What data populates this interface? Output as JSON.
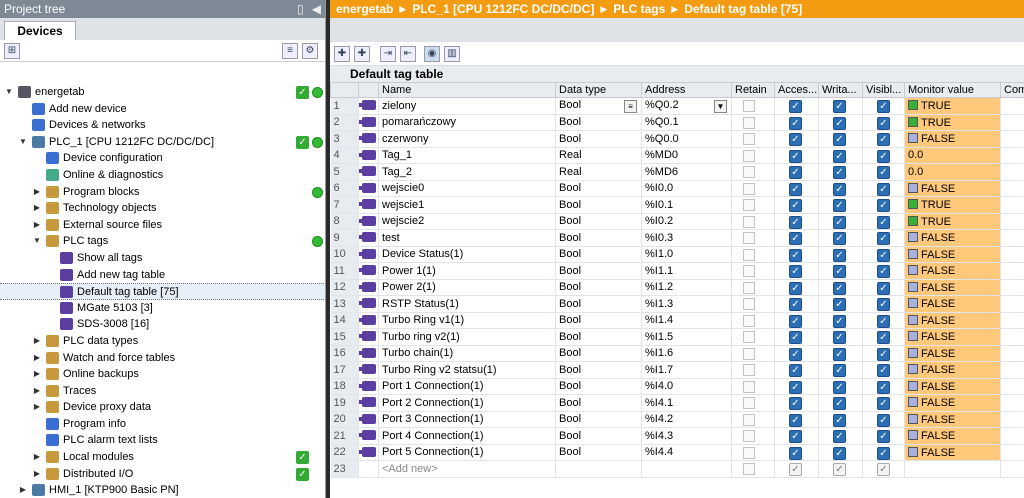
{
  "left_pane": {
    "title": "Project tree",
    "tab": "Devices",
    "tree": [
      {
        "label": "energetab",
        "icon": "project-icon",
        "level": 0,
        "expander": "▼",
        "check": true,
        "dot": true
      },
      {
        "label": "Add new device",
        "icon": "add-device-icon",
        "level": 1,
        "expander": "",
        "check": false,
        "dot": false
      },
      {
        "label": "Devices & networks",
        "icon": "network-icon",
        "level": 1,
        "expander": "",
        "check": false,
        "dot": false
      },
      {
        "label": "PLC_1 [CPU 1212FC DC/DC/DC]",
        "icon": "plc-icon",
        "level": 1,
        "expander": "▼",
        "check": true,
        "dot": true
      },
      {
        "label": "Device configuration",
        "icon": "device-config-icon",
        "level": 2,
        "expander": "",
        "check": false,
        "dot": false
      },
      {
        "label": "Online & diagnostics",
        "icon": "diagnostics-icon",
        "level": 2,
        "expander": "",
        "check": false,
        "dot": false
      },
      {
        "label": "Program blocks",
        "icon": "folder-icon",
        "level": 2,
        "expander": "▶",
        "check": false,
        "dot": true
      },
      {
        "label": "Technology objects",
        "icon": "folder-icon",
        "level": 2,
        "expander": "▶",
        "check": false,
        "dot": false
      },
      {
        "label": "External source files",
        "icon": "folder-icon",
        "level": 2,
        "expander": "▶",
        "check": false,
        "dot": false
      },
      {
        "label": "PLC tags",
        "icon": "folder-icon",
        "level": 2,
        "expander": "▼",
        "check": false,
        "dot": true
      },
      {
        "label": "Show all tags",
        "icon": "tags-icon",
        "level": 3,
        "expander": "",
        "check": false,
        "dot": false
      },
      {
        "label": "Add new tag table",
        "icon": "add-table-icon",
        "level": 3,
        "expander": "",
        "check": false,
        "dot": false
      },
      {
        "label": "Default tag table [75]",
        "icon": "tag-table-icon",
        "level": 3,
        "expander": "",
        "check": false,
        "dot": false,
        "selected": true
      },
      {
        "label": "MGate 5103 [3]",
        "icon": "tag-table-icon",
        "level": 3,
        "expander": "",
        "check": false,
        "dot": false
      },
      {
        "label": "SDS-3008 [16]",
        "icon": "tag-table-icon",
        "level": 3,
        "expander": "",
        "check": false,
        "dot": false
      },
      {
        "label": "PLC data types",
        "icon": "folder-icon",
        "level": 2,
        "expander": "▶",
        "check": false,
        "dot": false
      },
      {
        "label": "Watch and force tables",
        "icon": "folder-icon",
        "level": 2,
        "expander": "▶",
        "check": false,
        "dot": false
      },
      {
        "label": "Online backups",
        "icon": "folder-icon",
        "level": 2,
        "expander": "▶",
        "check": false,
        "dot": false
      },
      {
        "label": "Traces",
        "icon": "folder-icon",
        "level": 2,
        "expander": "▶",
        "check": false,
        "dot": false
      },
      {
        "label": "Device proxy data",
        "icon": "folder-icon",
        "level": 2,
        "expander": "▶",
        "check": false,
        "dot": false
      },
      {
        "label": "Program info",
        "icon": "info-icon",
        "level": 2,
        "expander": "",
        "check": false,
        "dot": false
      },
      {
        "label": "PLC alarm text lists",
        "icon": "alarm-list-icon",
        "level": 2,
        "expander": "",
        "check": false,
        "dot": false
      },
      {
        "label": "Local modules",
        "icon": "folder-icon",
        "level": 2,
        "expander": "▶",
        "check": true,
        "dot": false
      },
      {
        "label": "Distributed I/O",
        "icon": "folder-icon",
        "level": 2,
        "expander": "▶",
        "check": true,
        "dot": false
      },
      {
        "label": "HMI_1 [KTP900 Basic PN]",
        "icon": "hmi-icon",
        "level": 1,
        "expander": "▶",
        "check": false,
        "dot": false
      }
    ]
  },
  "breadcrumb": [
    "energetab",
    "PLC_1 [CPU 1212FC DC/DC/DC]",
    "PLC tags",
    "Default tag table [75]"
  ],
  "table_title": "Default tag table",
  "columns": [
    "Name",
    "Data type",
    "Address",
    "Retain",
    "Acces...",
    "Writa...",
    "Visibl...",
    "Monitor value",
    "Com"
  ],
  "rows": [
    {
      "n": "1",
      "name": "zielony",
      "type": "Bool",
      "addr": "%Q0.2",
      "mon": "TRUE",
      "state": "true"
    },
    {
      "n": "2",
      "name": "pomarańczowy",
      "type": "Bool",
      "addr": "%Q0.1",
      "mon": "TRUE",
      "state": "true"
    },
    {
      "n": "3",
      "name": "czerwony",
      "type": "Bool",
      "addr": "%Q0.0",
      "mon": "FALSE",
      "state": "false"
    },
    {
      "n": "4",
      "name": "Tag_1",
      "type": "Real",
      "addr": "%MD0",
      "mon": "0.0",
      "state": "none"
    },
    {
      "n": "5",
      "name": "Tag_2",
      "type": "Real",
      "addr": "%MD6",
      "mon": "0.0",
      "state": "none"
    },
    {
      "n": "6",
      "name": "wejscie0",
      "type": "Bool",
      "addr": "%I0.0",
      "mon": "FALSE",
      "state": "false"
    },
    {
      "n": "7",
      "name": "wejscie1",
      "type": "Bool",
      "addr": "%I0.1",
      "mon": "TRUE",
      "state": "true"
    },
    {
      "n": "8",
      "name": "wejscie2",
      "type": "Bool",
      "addr": "%I0.2",
      "mon": "TRUE",
      "state": "true"
    },
    {
      "n": "9",
      "name": "test",
      "type": "Bool",
      "addr": "%I0.3",
      "mon": "FALSE",
      "state": "false"
    },
    {
      "n": "10",
      "name": "Device Status(1)",
      "type": "Bool",
      "addr": "%I1.0",
      "mon": "FALSE",
      "state": "false"
    },
    {
      "n": "11",
      "name": "Power 1(1)",
      "type": "Bool",
      "addr": "%I1.1",
      "mon": "FALSE",
      "state": "false"
    },
    {
      "n": "12",
      "name": "Power 2(1)",
      "type": "Bool",
      "addr": "%I1.2",
      "mon": "FALSE",
      "state": "false"
    },
    {
      "n": "13",
      "name": "RSTP Status(1)",
      "type": "Bool",
      "addr": "%I1.3",
      "mon": "FALSE",
      "state": "false"
    },
    {
      "n": "14",
      "name": "Turbo Ring v1(1)",
      "type": "Bool",
      "addr": "%I1.4",
      "mon": "FALSE",
      "state": "false"
    },
    {
      "n": "15",
      "name": "Turbo ring v2(1)",
      "type": "Bool",
      "addr": "%I1.5",
      "mon": "FALSE",
      "state": "false"
    },
    {
      "n": "16",
      "name": "Turbo chain(1)",
      "type": "Bool",
      "addr": "%I1.6",
      "mon": "FALSE",
      "state": "false"
    },
    {
      "n": "17",
      "name": "Turbo Ring v2 statsu(1)",
      "type": "Bool",
      "addr": "%I1.7",
      "mon": "FALSE",
      "state": "false"
    },
    {
      "n": "18",
      "name": "Port 1 Connection(1)",
      "type": "Bool",
      "addr": "%I4.0",
      "mon": "FALSE",
      "state": "false"
    },
    {
      "n": "19",
      "name": "Port 2 Connection(1)",
      "type": "Bool",
      "addr": "%I4.1",
      "mon": "FALSE",
      "state": "false"
    },
    {
      "n": "20",
      "name": "Port 3 Connection(1)",
      "type": "Bool",
      "addr": "%I4.2",
      "mon": "FALSE",
      "state": "false"
    },
    {
      "n": "21",
      "name": "Port 4 Connection(1)",
      "type": "Bool",
      "addr": "%I4.3",
      "mon": "FALSE",
      "state": "false"
    },
    {
      "n": "22",
      "name": "Port 5 Connection(1)",
      "type": "Bool",
      "addr": "%I4.4",
      "mon": "FALSE",
      "state": "false"
    }
  ],
  "add_new_row": {
    "n": "23",
    "label": "<Add new>"
  },
  "colors": {
    "breadcrumb": "#f39c12",
    "monitor_bg": "#ffc87a",
    "true_indicator": "#38b038",
    "false_indicator": "#a8b0e0",
    "checkbox": "#2c6fb7"
  }
}
